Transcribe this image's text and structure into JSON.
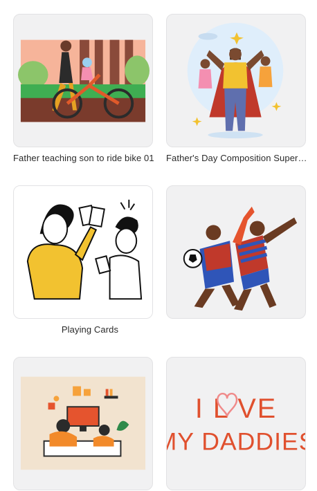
{
  "grid": {
    "items": [
      {
        "caption": "Father teaching son to ride bike 01",
        "illustration": "father-bike-illustration"
      },
      {
        "caption": "Father's Day Composition Super F...",
        "illustration": "superhero-dad-illustration"
      },
      {
        "caption": "Playing Cards",
        "illustration": "playing-cards-illustration"
      },
      {
        "caption": "",
        "illustration": "soccer-fans-illustration"
      },
      {
        "caption": "",
        "illustration": "father-son-gaming-illustration"
      },
      {
        "caption": "",
        "illustration": "i-love-my-daddies-illustration"
      }
    ]
  },
  "artwork": {
    "love_line1": "I L   VE",
    "love_line2": "MY DADDIES",
    "love_color": "#e0502e"
  }
}
